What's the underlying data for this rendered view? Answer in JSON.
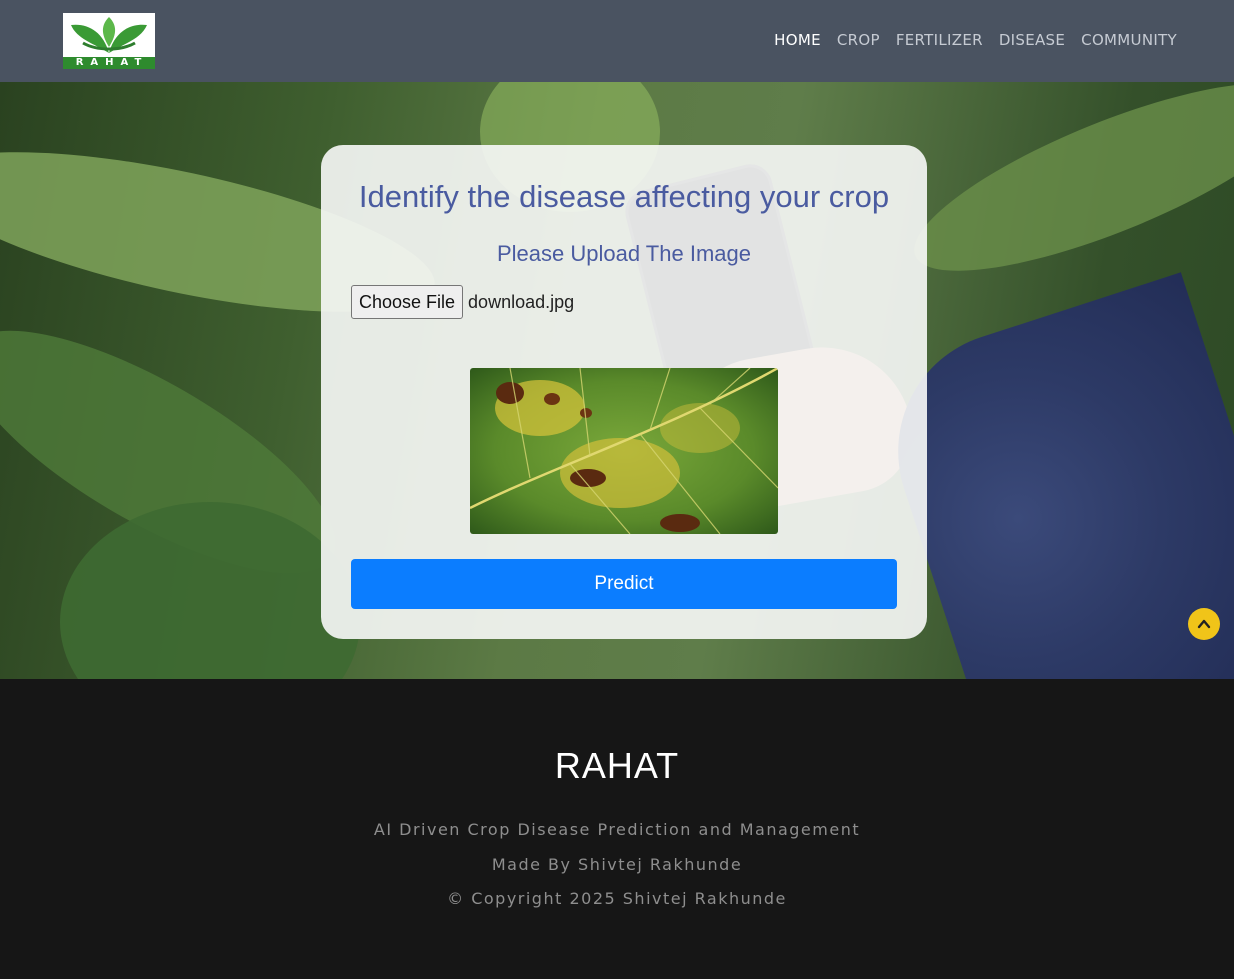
{
  "header": {
    "logo_text": "RAHAT",
    "nav": [
      {
        "label": "HOME",
        "active": true
      },
      {
        "label": "CROP",
        "active": false
      },
      {
        "label": "FERTILIZER",
        "active": false
      },
      {
        "label": "DISEASE",
        "active": false
      },
      {
        "label": "COMMUNITY",
        "active": false
      }
    ]
  },
  "card": {
    "title": "Identify the disease affecting your crop",
    "subtitle": "Please Upload The Image",
    "file_button": "Choose File",
    "file_name": "download.jpg",
    "predict_button": "Predict"
  },
  "footer": {
    "brand": "RAHAT",
    "tagline": "AI Driven Crop Disease Prediction and Management",
    "made_by": "Made By Shivtej Rakhunde",
    "copyright": "© Copyright 2025 Shivtej Rakhunde"
  },
  "colors": {
    "header_bg": "#4a5361",
    "accent_text": "#4a5ba0",
    "predict_button": "#0b7dff",
    "scroll_top": "#f0c419",
    "footer_bg": "#161616"
  },
  "icons": {
    "scroll_top": "chevron-up-icon"
  }
}
